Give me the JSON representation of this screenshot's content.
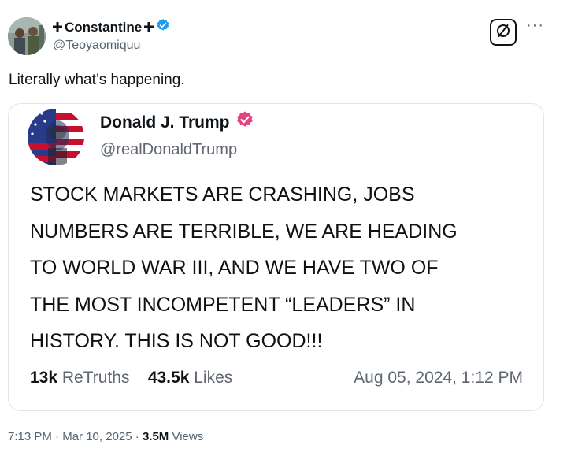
{
  "post": {
    "author_name": "Constantine",
    "author_handle": "@Teoyaomiquu",
    "text": "Literally what’s happening.",
    "time": "7:13 PM",
    "separator": "·",
    "date": "Mar 10, 2025",
    "views_count": "3.5M",
    "views_label": "Views",
    "more_label": "···"
  },
  "quote": {
    "name": "Donald J. Trump",
    "handle": "@realDonaldTrump",
    "lines": [
      "STOCK MARKETS ARE CRASHING, JOBS",
      "NUMBERS ARE TERRIBLE, WE ARE HEADING",
      "TO WORLD WAR III, AND WE HAVE TWO OF",
      "THE MOST INCOMPETENT “LEADERS” IN",
      "HISTORY. THIS IS NOT GOOD!!!"
    ],
    "retruths_count": "13k",
    "retruths_label": "ReTruths",
    "likes_count": "43.5k",
    "likes_label": "Likes",
    "timestamp": "Aug 05, 2024, 1:12 PM"
  },
  "colors": {
    "x_verified": "#1d9bf0",
    "truth_verified": "#e4437f"
  },
  "icons": {
    "author_badges": [
      "cross-icon",
      "verified-badge-icon"
    ],
    "grok": "grok-icon",
    "quote_badge": "verified-badge-icon"
  }
}
